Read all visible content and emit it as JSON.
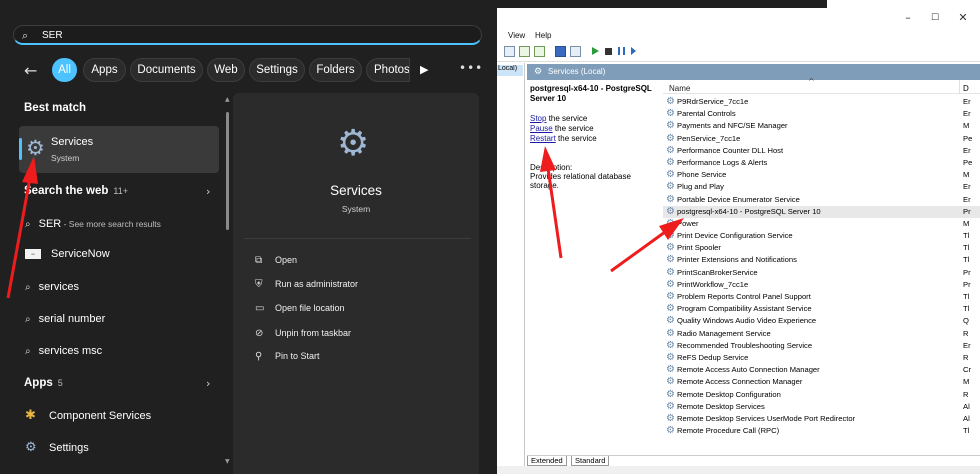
{
  "search": {
    "query": "SER"
  },
  "filters": {
    "items": [
      "All",
      "Apps",
      "Documents",
      "Web",
      "Settings",
      "Folders",
      "Photos"
    ]
  },
  "results": {
    "best_match_header": "Best match",
    "best": {
      "title": "Services",
      "subtitle": "System"
    },
    "web_header": "Search the web",
    "web_count": "11+",
    "web_items": [
      {
        "text": "SER",
        "sub": " - See more search results"
      },
      {
        "text": "ServiceNow"
      },
      {
        "text": "services"
      },
      {
        "text": "serial number"
      },
      {
        "text": "services msc"
      }
    ],
    "apps_header": "Apps",
    "apps_count": "5",
    "apps": [
      {
        "text": "Component Services"
      },
      {
        "text": "Settings"
      }
    ]
  },
  "detail": {
    "title": "Services",
    "subtitle": "System",
    "actions": [
      "Open",
      "Run as administrator",
      "Open file location",
      "Unpin from taskbar",
      "Pin to Start"
    ]
  },
  "services_window": {
    "menu": [
      "View",
      "Help"
    ],
    "tree_node": "Local)",
    "header": "Services (Local)",
    "selected_title": "postgresql-x64-10 - PostgreSQL Server 10",
    "links": {
      "stop": "Stop",
      "pause": "Pause",
      "restart": "Restart",
      "suffix": " the service"
    },
    "description_label": "Description:",
    "description_text": "Provides relational database storage.",
    "col_name": "Name",
    "col_d": "D",
    "rows": [
      {
        "name": "P9RdrService_7cc1e",
        "s": "Er"
      },
      {
        "name": "Parental Controls",
        "s": "Er"
      },
      {
        "name": "Payments and NFC/SE Manager",
        "s": "M"
      },
      {
        "name": "PenService_7cc1e",
        "s": "Pe"
      },
      {
        "name": "Performance Counter DLL Host",
        "s": "Er"
      },
      {
        "name": "Performance Logs & Alerts",
        "s": "Pe"
      },
      {
        "name": "Phone Service",
        "s": "M"
      },
      {
        "name": "Plug and Play",
        "s": "Er"
      },
      {
        "name": "Portable Device Enumerator Service",
        "s": "Er"
      },
      {
        "name": "postgresql-x64-10 - PostgreSQL Server 10",
        "s": "Pr"
      },
      {
        "name": "Power",
        "s": "M"
      },
      {
        "name": "Print Device Configuration Service",
        "s": "Tl"
      },
      {
        "name": "Print Spooler",
        "s": "Tl"
      },
      {
        "name": "Printer Extensions and Notifications",
        "s": "Tl"
      },
      {
        "name": "PrintScanBrokerService",
        "s": "Pr"
      },
      {
        "name": "PrintWorkflow_7cc1e",
        "s": "Pr"
      },
      {
        "name": "Problem Reports Control Panel Support",
        "s": "Tl"
      },
      {
        "name": "Program Compatibility Assistant Service",
        "s": "Tl"
      },
      {
        "name": "Quality Windows Audio Video Experience",
        "s": "Q"
      },
      {
        "name": "Radio Management Service",
        "s": "R"
      },
      {
        "name": "Recommended Troubleshooting Service",
        "s": "Er"
      },
      {
        "name": "ReFS Dedup Service",
        "s": "R"
      },
      {
        "name": "Remote Access Auto Connection Manager",
        "s": "Cr"
      },
      {
        "name": "Remote Access Connection Manager",
        "s": "M"
      },
      {
        "name": "Remote Desktop Configuration",
        "s": "R"
      },
      {
        "name": "Remote Desktop Services",
        "s": "Al"
      },
      {
        "name": "Remote Desktop Services UserMode Port Redirector",
        "s": "Al"
      },
      {
        "name": "Remote Procedure Call (RPC)",
        "s": "Tl"
      }
    ],
    "tabs": [
      "Extended",
      "Standard"
    ]
  },
  "colors": {
    "accent": "#4cc2ff",
    "arrow": "#ee1c1c",
    "panel": "#202020"
  }
}
